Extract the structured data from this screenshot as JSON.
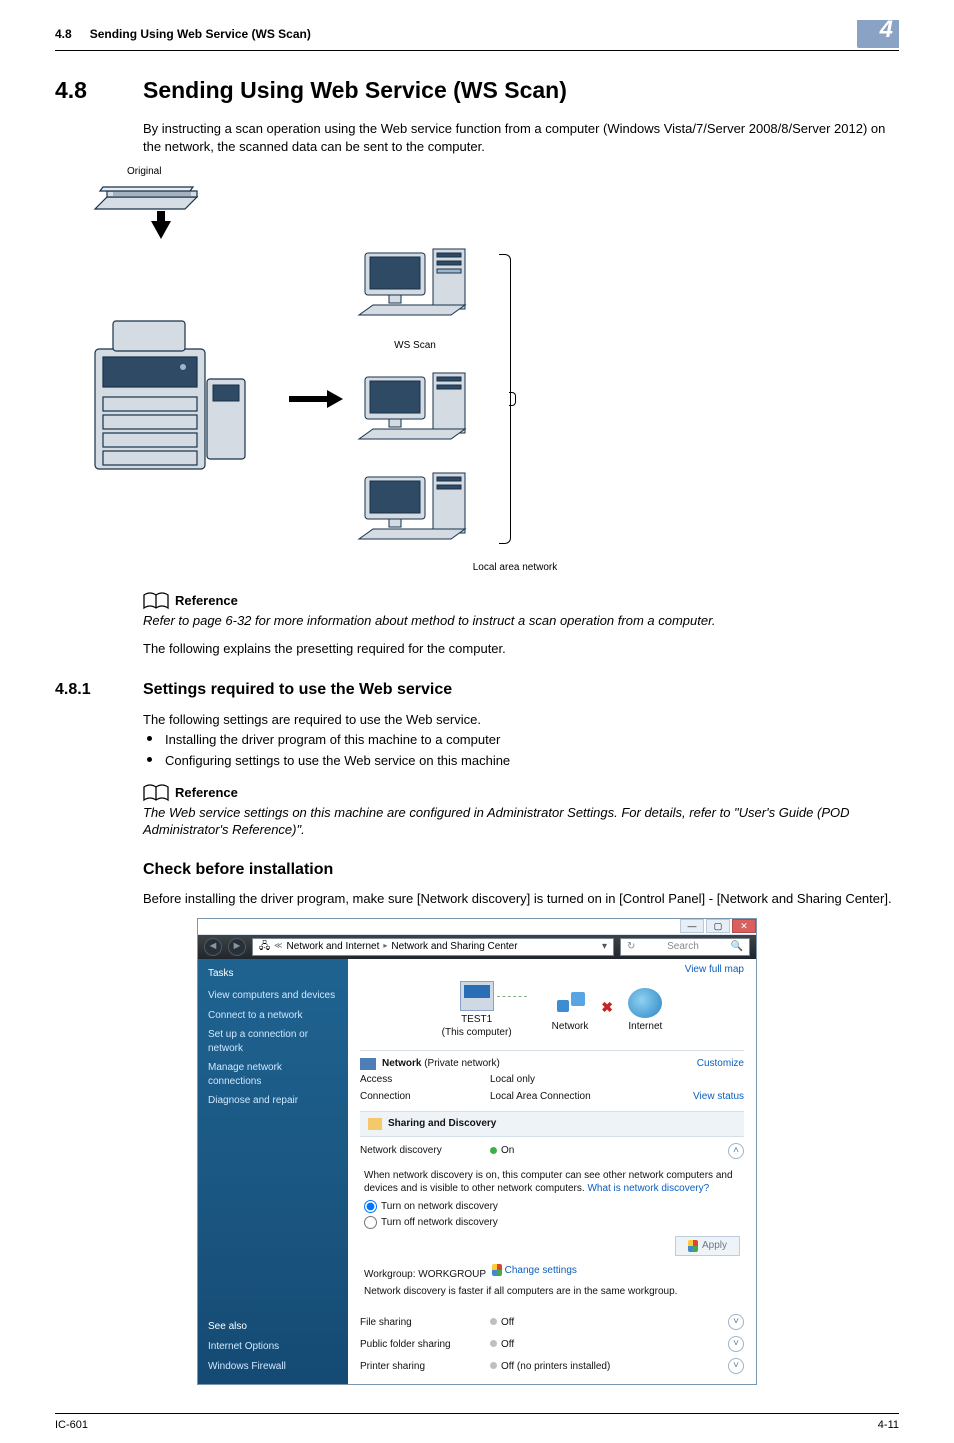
{
  "header": {
    "num": "4.8",
    "title": "Sending Using Web Service (WS Scan)",
    "tab": "4"
  },
  "section": {
    "num": "4.8",
    "title": "Sending Using Web Service (WS Scan)",
    "intro": "By instructing a scan operation using the Web service function from a computer (Windows Vista/7/Server 2008/8/Server 2012) on the network, the scanned data can be sent to the computer."
  },
  "diagram": {
    "original": "Original",
    "ws_scan": "WS Scan",
    "local_area": "Local area network"
  },
  "reference1": {
    "head": "Reference",
    "body": "Refer to page 6-32 for more information about method to instruct a scan operation from a computer.",
    "after": "The following explains the presetting required for the computer."
  },
  "subsection": {
    "num": "4.8.1",
    "title": "Settings required to use the Web service",
    "lead": "The following settings are required to use the Web service.",
    "bullets": [
      "Installing the driver program of this machine to a computer",
      "Configuring settings to use the Web service on this machine"
    ]
  },
  "reference2": {
    "head": "Reference",
    "body": "The Web service settings on this machine are configured in Administrator Settings. For details, refer to \"User's Guide (POD Administrator's Reference)\"."
  },
  "check": {
    "title": "Check before installation",
    "para": "Before installing the driver program, make sure [Network discovery] is turned on in [Control Panel] - [Network and Sharing Center]."
  },
  "dialog": {
    "path1": "Network and Internet",
    "path2": "Network and Sharing Center",
    "search_placeholder": "Search",
    "view_full_map": "View full map",
    "tasks_head": "Tasks",
    "tasks": [
      "View computers and devices",
      "Connect to a network",
      "Set up a connection or network",
      "Manage network connections",
      "Diagnose and repair"
    ],
    "see_also_head": "See also",
    "see_also": [
      "Internet Options",
      "Windows Firewall"
    ],
    "pc_label": "TEST1",
    "pc_sub": "(This computer)",
    "net_label": "Network",
    "inet_label": "Internet",
    "net_private": "Network",
    "net_private_suffix": " (Private network)",
    "customize": "Customize",
    "access_k": "Access",
    "access_v": "Local only",
    "conn_k": "Connection",
    "conn_v": "Local Area Connection",
    "view_status": "View status",
    "panel_title": "Sharing and Discovery",
    "disc_k": "Network discovery",
    "disc_on": "On",
    "disc_desc_a": "When network discovery is on, this computer can see other network computers and devices and is visible to other network computers. ",
    "disc_desc_link": "What is network discovery?",
    "radio_on": "Turn on network discovery",
    "radio_off": "Turn off network discovery",
    "apply": "Apply",
    "wg_label": "Workgroup: WORKGROUP",
    "change_settings": "Change settings",
    "faster_note": "Network discovery is faster if all computers are in the same workgroup.",
    "rows": [
      {
        "k": "File sharing",
        "v": "Off"
      },
      {
        "k": "Public folder sharing",
        "v": "Off"
      },
      {
        "k": "Printer sharing",
        "v": "Off (no printers installed)"
      }
    ]
  },
  "footer": {
    "left": "IC-601",
    "right": "4-11"
  }
}
